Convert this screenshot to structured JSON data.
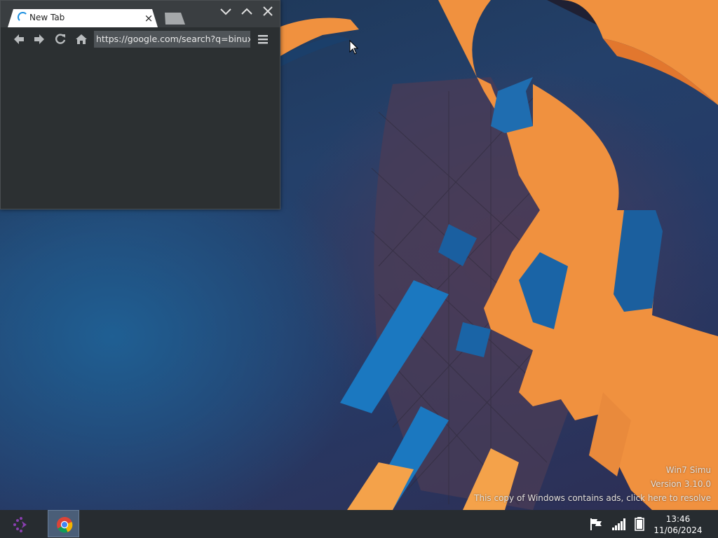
{
  "browser": {
    "tab": {
      "title": "New Tab",
      "close_symbol": "×"
    },
    "address_bar": {
      "value": "https://google.com/search?q=binux"
    },
    "window_controls": [
      "minimize-icon",
      "maximize-icon",
      "close-icon"
    ],
    "toolbar_icons": [
      "back-arrow-icon",
      "forward-arrow-icon",
      "reload-icon",
      "home-icon",
      "menu-icon"
    ]
  },
  "watermark": {
    "line1": "Win7 Simu",
    "line2": "Version 3.10.0",
    "line3": "This copy of Windows contains ads, click here to resolve"
  },
  "taskbar": {
    "start_icon": "start-logo-icon",
    "pinned": [
      {
        "name": "chrome-icon",
        "active": true
      }
    ],
    "tray_icons": [
      "flag-icon",
      "signal-icon",
      "battery-icon"
    ],
    "clock": {
      "time": "13:46",
      "date": "11/06/2024"
    }
  },
  "colors": {
    "accent_orange": "#f0913f",
    "accent_blue": "#1b78c0",
    "taskbar": "#272c30",
    "browser_bg": "#2b2f31"
  }
}
